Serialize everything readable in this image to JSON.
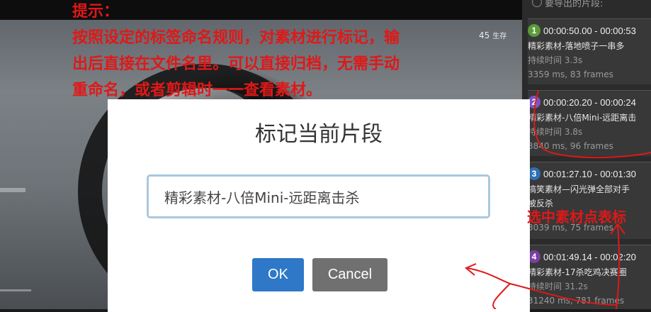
{
  "annotation": {
    "title": "提示：",
    "lines": [
      "按照设定的标签命名规则，对素材进行标记，输",
      "出后直接在文件名里。可以直接归档，无需手动",
      "重命名，或者剪辑时一一查看素材。"
    ],
    "color": "#e01818"
  },
  "video": {
    "hud_number": "45",
    "hud_label": "生存"
  },
  "dialog": {
    "title": "标记当前片段",
    "input_value": "精彩素材-八倍Mini-远距离击杀",
    "ok_label": "OK",
    "cancel_label": "Cancel",
    "ok_color": "#2e78c7",
    "cancel_color": "#707070"
  },
  "sidebar": {
    "header": "要导出的片段:",
    "clips": [
      {
        "index": "1",
        "badge_color": "#5a9a3a",
        "time": "00:00:50.00 - 00:00:53",
        "name": "精彩素材-落地喷子一串多",
        "duration": "持续时间 3.3s",
        "frames": "3359 ms, 83 frames"
      },
      {
        "index": "2",
        "badge_color": "#7a57c2",
        "time": "00:00:20.20 - 00:00:24",
        "name": "精彩素材-八倍Mini-远距离击",
        "duration": "持续时间 3.8s",
        "frames": "3840 ms, 96 frames"
      },
      {
        "index": "3",
        "badge_color": "#2e6fb5",
        "time": "00:01:27.10 - 00:01:30",
        "name": "搞笑素材—闪光弹全部对手",
        "name2": "被反杀",
        "duration": "",
        "frames": "3039 ms, 75 frames"
      },
      {
        "index": "4",
        "badge_color": "#7a3fa6",
        "time": "00:01:49.14 - 00:02:20",
        "name": "精彩素材-17杀吃鸡决赛圈",
        "duration": "持续时间 31.2s",
        "frames": "31240 ms, 781 frames"
      }
    ]
  },
  "sidenote": "选中素材点表标"
}
